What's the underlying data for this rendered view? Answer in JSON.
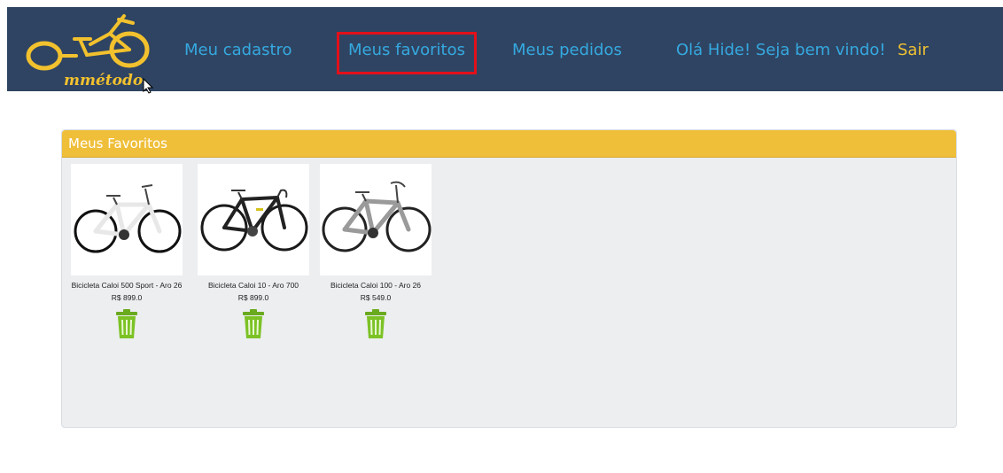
{
  "header": {
    "logo_text": "mmétodo",
    "nav": [
      {
        "label": "Meu cadastro"
      },
      {
        "label": "Meus favoritos",
        "highlighted": true
      },
      {
        "label": "Meus pedidos"
      }
    ],
    "greeting": "Olá Hide! Seja bem vindo!",
    "logout_label": "Sair"
  },
  "favorites": {
    "title": "Meus Favoritos",
    "items": [
      {
        "name": "Bicicleta Caloi 500 Sport - Aro 26",
        "price": "R$ 899.0",
        "image_icon": "white-mountain-bike"
      },
      {
        "name": "Bicicleta Caloi 10 - Aro 700",
        "price": "R$ 899.0",
        "image_icon": "black-road-bike"
      },
      {
        "name": "Bicicleta Caloi 100 - Aro 26",
        "price": "R$ 549.0",
        "image_icon": "gray-city-bike"
      }
    ],
    "remove_icon": "trash-icon"
  },
  "colors": {
    "header_bg": "#2f4462",
    "nav_link": "#35a9e0",
    "logout": "#efc131",
    "panel_header": "#efbf3a",
    "panel_bg": "#eceef0",
    "highlight_box": "#e3101a",
    "trash_green": "#7cc225"
  }
}
